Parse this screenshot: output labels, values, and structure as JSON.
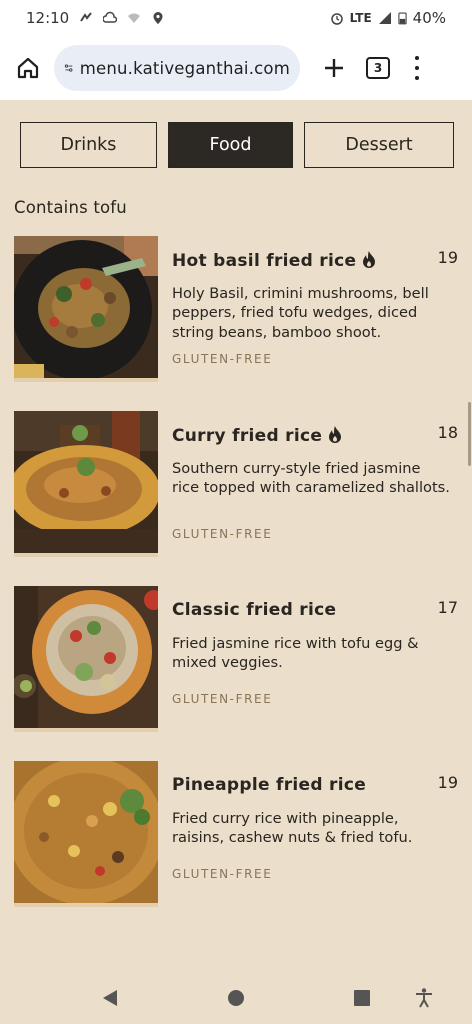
{
  "status": {
    "time": "12:10",
    "network": "LTE",
    "battery": "40%"
  },
  "browser": {
    "url": "menu.kativeganthai.com",
    "tab_count": "3"
  },
  "tabs": [
    {
      "label": "Drinks",
      "active": false
    },
    {
      "label": "Food",
      "active": true
    },
    {
      "label": "Dessert",
      "active": false
    }
  ],
  "section_title": "Contains tofu",
  "items": [
    {
      "name": "Hot basil fried rice",
      "spicy": true,
      "price": "19",
      "description": "Holy Basil, crimini mushrooms, bell peppers, fried tofu wedges, diced string beans, bamboo shoot.",
      "tag": "GLUTEN-FREE",
      "photo": "dark-plate-basil-rice"
    },
    {
      "name": "Curry fried rice",
      "spicy": true,
      "price": "18",
      "description": "Southern curry-style fried jasmine rice topped with caramelized shallots.",
      "tag": "GLUTEN-FREE",
      "photo": "yellow-plate-curry-rice"
    },
    {
      "name": "Classic fried rice",
      "spicy": false,
      "price": "17",
      "description": "Fried jasmine rice with tofu egg & mixed veggies.",
      "tag": "GLUTEN-FREE",
      "photo": "orange-plate-classic-rice"
    },
    {
      "name": "Pineapple fried rice",
      "spicy": false,
      "price": "19",
      "description": "Fried curry rice with pineapple, raisins, cashew nuts & fried tofu.",
      "tag": "GLUTEN-FREE",
      "photo": "closeup-pineapple-rice"
    }
  ],
  "colors": {
    "page_background": "#ebdeca",
    "text": "#2a2520",
    "active_tab": "#2c2824",
    "tag": "#8a7456"
  },
  "icons": {
    "spicy": "flame-icon",
    "home": "home-icon",
    "site_settings": "tune-icon",
    "new_tab": "plus-icon",
    "menu": "more-vert-icon"
  }
}
